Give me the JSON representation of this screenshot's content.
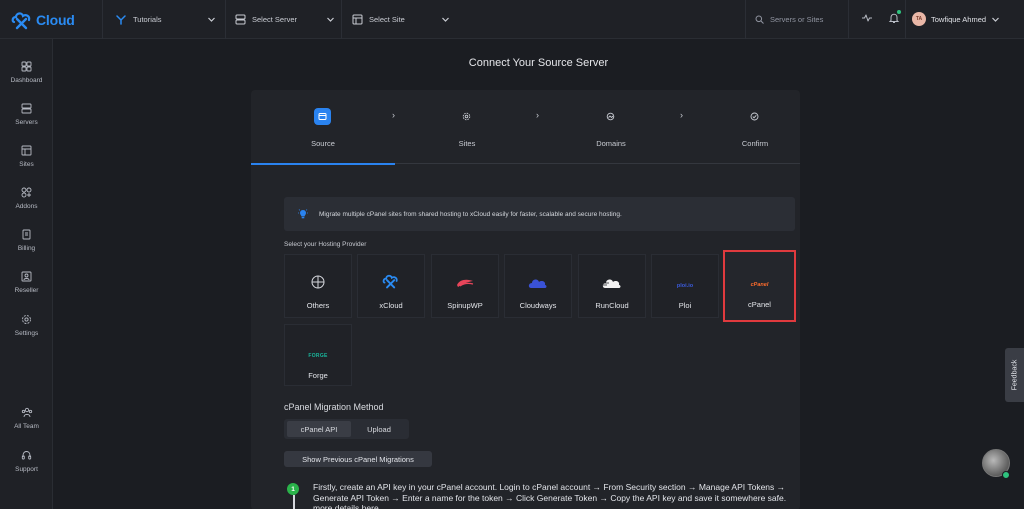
{
  "app": {
    "logo_text": "Cloud"
  },
  "topbar": {
    "tutorials_label": "Tutorials",
    "server_label": "Select Server",
    "site_label": "Select Site",
    "search_placeholder": "Servers or Sites",
    "user_initials": "TA",
    "user_name": "Towfique Ahmed"
  },
  "sidebar": {
    "items": [
      {
        "label": "Dashboard",
        "icon": "dashboard-icon"
      },
      {
        "label": "Servers",
        "icon": "servers-icon"
      },
      {
        "label": "Sites",
        "icon": "sites-icon"
      },
      {
        "label": "Addons",
        "icon": "addons-icon"
      },
      {
        "label": "Billing",
        "icon": "billing-icon"
      },
      {
        "label": "Reseller",
        "icon": "reseller-icon"
      },
      {
        "label": "Settings",
        "icon": "settings-icon"
      },
      {
        "label": "All Team",
        "icon": "team-icon"
      },
      {
        "label": "Support",
        "icon": "support-icon"
      }
    ]
  },
  "page": {
    "title": "Connect Your Source Server"
  },
  "steps": [
    {
      "label": "Source",
      "active": true
    },
    {
      "label": "Sites"
    },
    {
      "label": "Domains"
    },
    {
      "label": "Confirm"
    }
  ],
  "banner": {
    "text": "Migrate multiple cPanel sites from shared hosting to xCloud easily for faster, scalable and secure hosting."
  },
  "hosting": {
    "label": "Select your Hosting Provider",
    "providers": [
      {
        "name": "Others"
      },
      {
        "name": "xCloud"
      },
      {
        "name": "SpinupWP"
      },
      {
        "name": "Cloudways"
      },
      {
        "name": "RunCloud"
      },
      {
        "name": "Ploi",
        "logo_text": "ploi.io"
      },
      {
        "name": "cPanel",
        "logo_text": "cPanel",
        "selected": true
      },
      {
        "name": "Forge",
        "logo_text": "FORGE"
      }
    ]
  },
  "migration": {
    "title": "cPanel Migration Method",
    "tabs": [
      {
        "label": "cPanel API",
        "active": true
      },
      {
        "label": "Upload"
      }
    ],
    "show_previous_button": "Show Previous cPanel Migrations",
    "step_number": "1",
    "instruction": "Firstly, create an API key in your cPanel account. Login to cPanel account → From Security section → Manage API Tokens → Generate API Token → Enter a name for the token → Click Generate Token → Copy the API key and save it somewhere safe. more details here"
  },
  "feedback_label": "Feedback",
  "colors": {
    "accent": "#2a83f0",
    "selected_border": "#e03a3e",
    "success": "#2ab34a"
  }
}
